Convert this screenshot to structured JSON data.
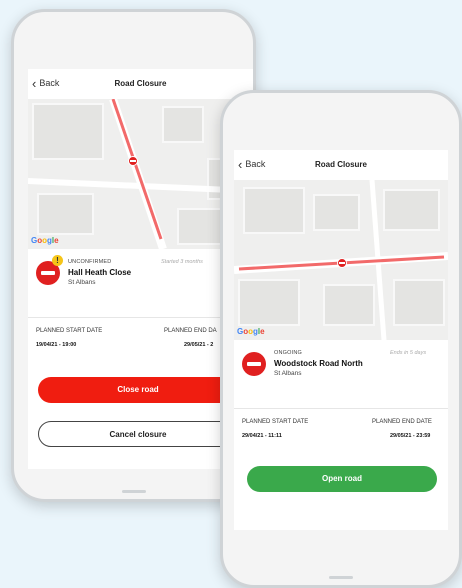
{
  "colors": {
    "background": "#eaf5fb",
    "close_button": "#f01d10",
    "open_button": "#3aa94b",
    "route_line": "#f26a6a"
  },
  "left_phone": {
    "back_label": "Back",
    "title": "Road Closure",
    "google": [
      "G",
      "o",
      "o",
      "g",
      "l",
      "e"
    ],
    "status": "UNCONFIRMED",
    "road_name": "Hall Heath Close",
    "town": "St Albans",
    "meta": "Started 3 months",
    "start_label": "PLANNED START DATE",
    "start_value": "19/04/21 - 19:00",
    "end_label": "PLANNED END DA",
    "end_value": "29/05/21 - 2",
    "primary_button": "Close road",
    "secondary_button": "Cancel closure",
    "warning_badge": "!"
  },
  "right_phone": {
    "back_label": "Back",
    "title": "Road Closure",
    "google": [
      "G",
      "o",
      "o",
      "g",
      "l",
      "e"
    ],
    "status": "ONGOING",
    "road_name": "Woodstock Road North",
    "town": "St Albans",
    "meta": "Ends in 5 days",
    "start_label": "PLANNED START DATE",
    "start_value": "29/04/21 - 11:11",
    "end_label": "PLANNED END DATE",
    "end_value": "29/05/21 - 23:59",
    "primary_button": "Open road"
  }
}
